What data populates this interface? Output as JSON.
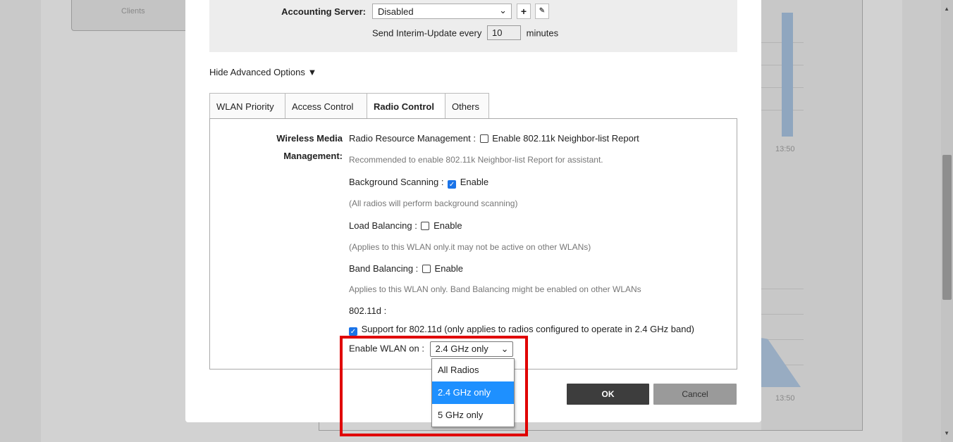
{
  "background": {
    "clients_label": "Clients",
    "tick_top": "13:50",
    "tick_bottom": "13:50"
  },
  "accounting": {
    "label": "Accounting Server:",
    "server_value": "Disabled",
    "add_icon": "plus-icon",
    "edit_icon": "pencil-icon",
    "interim_prefix": "Send Interim-Update every",
    "interim_value": "10",
    "interim_suffix": "minutes"
  },
  "advanced_toggle": "Hide Advanced Options ▼",
  "tabs": [
    {
      "label": "WLAN Priority",
      "active": false
    },
    {
      "label": "Access Control",
      "active": false
    },
    {
      "label": "Radio Control",
      "active": true
    },
    {
      "label": "Others",
      "active": false
    }
  ],
  "radio_control": {
    "section_label_1": "Wireless Media",
    "section_label_2": "Management:",
    "rrm_label": "Radio Resource Management :",
    "rrm_checkbox": "Enable 802.11k Neighbor-list Report",
    "rrm_checked": false,
    "rrm_hint": "Recommended to enable 802.11k Neighbor-list Report for assistant.",
    "bg_scan_label": "Background Scanning :",
    "bg_scan_checkbox": "Enable",
    "bg_scan_checked": true,
    "bg_scan_hint": "(All radios will perform background scanning)",
    "load_bal_label": "Load Balancing :",
    "load_bal_checkbox": "Enable",
    "load_bal_checked": false,
    "load_bal_hint": "(Applies to this WLAN only.it may not be active on other WLANs)",
    "band_bal_label": "Band Balancing :",
    "band_bal_checkbox": "Enable",
    "band_bal_checked": false,
    "band_bal_hint": "Applies to this WLAN only. Band Balancing might be enabled on other WLANs",
    "d11_label": "802.11d :",
    "d11_checkbox": "Support for 802.11d (only applies to radios configured to operate in 2.4 GHz band)",
    "d11_checked": true,
    "enable_wlan_label": "Enable WLAN on :",
    "enable_wlan_value": "2.4 GHz only"
  },
  "dropdown_options": [
    "All Radios",
    "2.4 GHz only",
    "5 GHz only"
  ],
  "dropdown_selected": "2.4 GHz only",
  "buttons": {
    "ok": "OK",
    "cancel": "Cancel"
  },
  "colors": {
    "highlight": "#e00000",
    "selected_option": "#1e90ff",
    "ok_button": "#3d3d3d"
  }
}
